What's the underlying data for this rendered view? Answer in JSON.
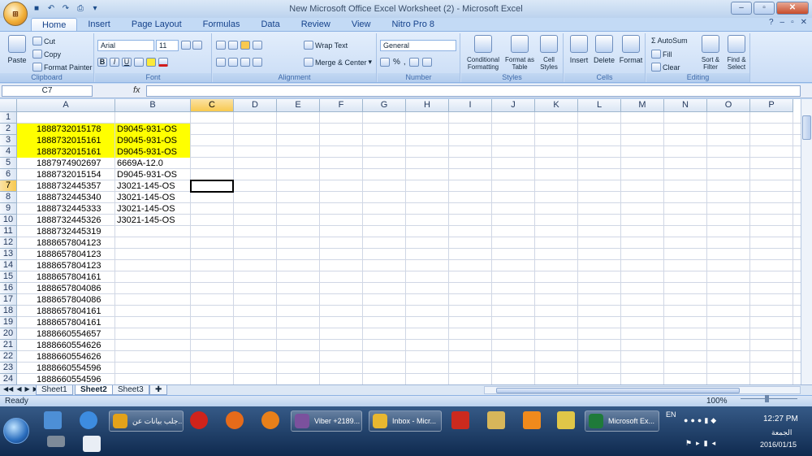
{
  "window": {
    "title": "New Microsoft Office Excel Worksheet (2) - Microsoft Excel",
    "controls": [
      "–",
      "▫",
      "✕"
    ]
  },
  "tabs": [
    "Home",
    "Insert",
    "Page Layout",
    "Formulas",
    "Data",
    "Review",
    "View",
    "Nitro Pro 8"
  ],
  "active_tab": "Home",
  "ribbon": {
    "clipboard": {
      "label": "Clipboard",
      "paste": "Paste",
      "cut": "Cut",
      "copy": "Copy",
      "format_painter": "Format Painter"
    },
    "font": {
      "label": "Font",
      "name": "Arial",
      "size": "11"
    },
    "alignment": {
      "label": "Alignment",
      "wrap": "Wrap Text",
      "merge": "Merge & Center"
    },
    "number": {
      "label": "Number",
      "format": "General"
    },
    "styles": {
      "label": "Styles",
      "conditional": "Conditional Formatting",
      "as_table": "Format as Table",
      "cell_styles": "Cell Styles"
    },
    "cells": {
      "label": "Cells",
      "insert": "Insert",
      "delete": "Delete",
      "format": "Format"
    },
    "editing": {
      "label": "Editing",
      "autosum": "AutoSum",
      "fill": "Fill",
      "clear": "Clear",
      "sort": "Sort & Filter",
      "find": "Find & Select"
    }
  },
  "formula_bar": {
    "name_box": "C7",
    "fx": "fx",
    "value": ""
  },
  "columns": [
    "A",
    "B",
    "C",
    "D",
    "E",
    "F",
    "G",
    "H",
    "I",
    "J",
    "K",
    "L",
    "M",
    "N",
    "O",
    "P"
  ],
  "selected_column": "C",
  "selected_row": 7,
  "rows": [
    {
      "n": "1",
      "a": "",
      "b": "",
      "hl": false
    },
    {
      "n": "2",
      "a": "1888732015178",
      "b": "D9045-931-OS",
      "hl": true
    },
    {
      "n": "3",
      "a": "1888732015161",
      "b": "D9045-931-OS",
      "hl": true
    },
    {
      "n": "4",
      "a": "1888732015161",
      "b": "D9045-931-OS",
      "hl": true
    },
    {
      "n": "5",
      "a": "1887974902697",
      "b": "6669A-12.0",
      "hl": false
    },
    {
      "n": "6",
      "a": "1888732015154",
      "b": "D9045-931-OS",
      "hl": false
    },
    {
      "n": "7",
      "a": "1888732445357",
      "b": "J3021-145-OS",
      "hl": false
    },
    {
      "n": "8",
      "a": "1888732445340",
      "b": "J3021-145-OS",
      "hl": false
    },
    {
      "n": "9",
      "a": "1888732445333",
      "b": "J3021-145-OS",
      "hl": false
    },
    {
      "n": "10",
      "a": "1888732445326",
      "b": "J3021-145-OS",
      "hl": false
    },
    {
      "n": "11",
      "a": "1888732445319",
      "b": "",
      "hl": false
    },
    {
      "n": "12",
      "a": "1888657804123",
      "b": "",
      "hl": false
    },
    {
      "n": "13",
      "a": "1888657804123",
      "b": "",
      "hl": false
    },
    {
      "n": "14",
      "a": "1888657804123",
      "b": "",
      "hl": false
    },
    {
      "n": "15",
      "a": "1888657804161",
      "b": "",
      "hl": false
    },
    {
      "n": "16",
      "a": "1888657804086",
      "b": "",
      "hl": false
    },
    {
      "n": "17",
      "a": "1888657804086",
      "b": "",
      "hl": false
    },
    {
      "n": "18",
      "a": "1888657804161",
      "b": "",
      "hl": false
    },
    {
      "n": "19",
      "a": "1888657804161",
      "b": "",
      "hl": false
    },
    {
      "n": "20",
      "a": "1888660554657",
      "b": "",
      "hl": false
    },
    {
      "n": "21",
      "a": "1888660554626",
      "b": "",
      "hl": false
    },
    {
      "n": "22",
      "a": "1888660554626",
      "b": "",
      "hl": false
    },
    {
      "n": "23",
      "a": "1888660554596",
      "b": "",
      "hl": false
    },
    {
      "n": "24",
      "a": "1888660554596",
      "b": "",
      "hl": false
    }
  ],
  "highlight_color": "#ffff00",
  "sheets": [
    "Sheet1",
    "Sheet2",
    "Sheet3"
  ],
  "active_sheet": "Sheet2",
  "status": {
    "ready": "Ready",
    "zoom": "100%"
  },
  "taskbar": {
    "items": [
      {
        "label": "جلب بيانات عن...",
        "icon": "chrome-icon",
        "color": "#e3a21a"
      },
      {
        "label": "Viber +2189...",
        "icon": "viber-icon",
        "color": "#7b519d"
      },
      {
        "label": "Inbox - Micr...",
        "icon": "outlook-icon",
        "color": "#e8b730"
      },
      {
        "label": "Microsoft Ex...",
        "icon": "excel-icon",
        "color": "#1f7a3a"
      }
    ],
    "lang": "EN",
    "time": "12:27 PM",
    "day": "الجمعة",
    "date": "2016/01/15"
  }
}
